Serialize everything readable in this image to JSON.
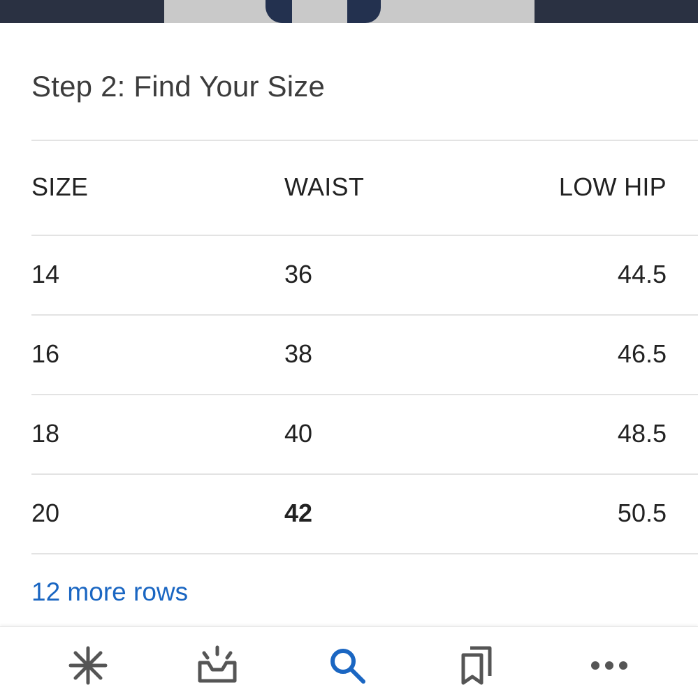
{
  "heading": "Step 2: Find Your Size",
  "table": {
    "headers": [
      "SIZE",
      "WAIST",
      "LOW HIP"
    ],
    "rows": [
      [
        "14",
        "36",
        "44.5"
      ],
      [
        "16",
        "38",
        "46.5"
      ],
      [
        "18",
        "40",
        "48.5"
      ],
      [
        "20",
        "42",
        "50.5"
      ]
    ]
  },
  "more_rows_label": "12 more rows",
  "bottom_nav": {
    "items": [
      {
        "icon": "discover-icon",
        "active": false
      },
      {
        "icon": "updates-icon",
        "active": false
      },
      {
        "icon": "search-icon",
        "active": true
      },
      {
        "icon": "collections-icon",
        "active": false
      },
      {
        "icon": "more-icon",
        "active": false
      }
    ],
    "active_color": "#1a66c2",
    "inactive_color": "#555555"
  },
  "colors": {
    "link": "#1a66c2",
    "text": "#222222",
    "heading": "#3c3c3c",
    "divider": "#e3e3e3"
  }
}
